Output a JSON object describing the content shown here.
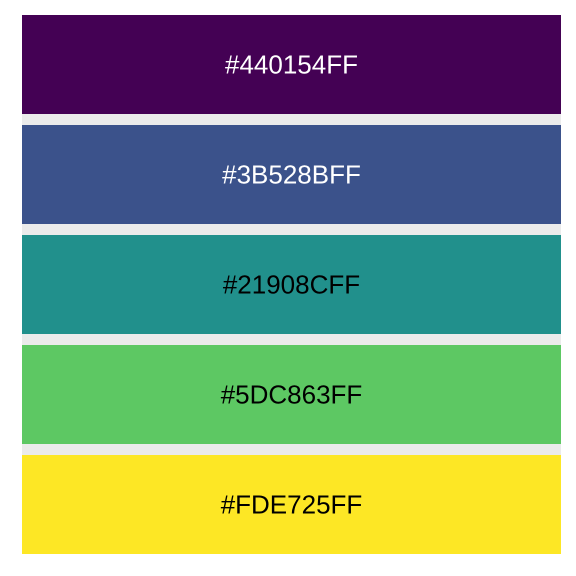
{
  "chart_data": {
    "type": "table",
    "title": "",
    "swatches": [
      {
        "label": "#440154FF",
        "color": "#440154",
        "text_color": "#ffffff"
      },
      {
        "label": "#3B528BFF",
        "color": "#3B528B",
        "text_color": "#ffffff"
      },
      {
        "label": "#21908CFF",
        "color": "#21908C",
        "text_color": "#000000"
      },
      {
        "label": "#5DC863FF",
        "color": "#5DC863",
        "text_color": "#000000"
      },
      {
        "label": "#FDE725FF",
        "color": "#FDE725",
        "text_color": "#000000"
      }
    ],
    "panel_background": "#EBEBEB",
    "grid": false,
    "legend": "none"
  }
}
